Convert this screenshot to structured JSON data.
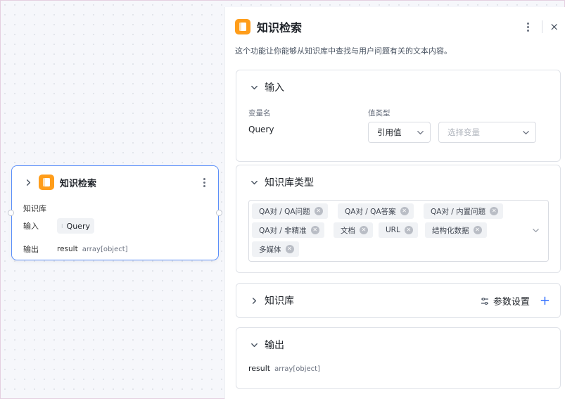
{
  "node": {
    "title": "知识检索",
    "kb_label": "知识库",
    "input_label": "输入",
    "input_value": "Query",
    "output_label": "输出",
    "output_name": "result",
    "output_type": "array[object]"
  },
  "panel": {
    "title": "知识检索",
    "description": "这个功能让你能够从知识库中查找与用户问题有关的文本内容。",
    "close_glyph": "×"
  },
  "input_section": {
    "title": "输入",
    "var_name_label": "变量名",
    "value_type_label": "值类型",
    "var_name": "Query",
    "value_type_selected": "引用值",
    "variable_placeholder": "选择变量"
  },
  "kb_type_section": {
    "title": "知识库类型",
    "tags": [
      "QA对 / QA问题",
      "QA对 / QA答案",
      "QA对 / 内置问题",
      "QA对 / 非精准",
      "文档",
      "URL",
      "结构化数据",
      "多媒体"
    ]
  },
  "kb_section": {
    "title": "知识库",
    "settings_label": "参数设置",
    "add_glyph": "+"
  },
  "output_section": {
    "title": "输出",
    "name": "result",
    "type": "array[object]"
  }
}
